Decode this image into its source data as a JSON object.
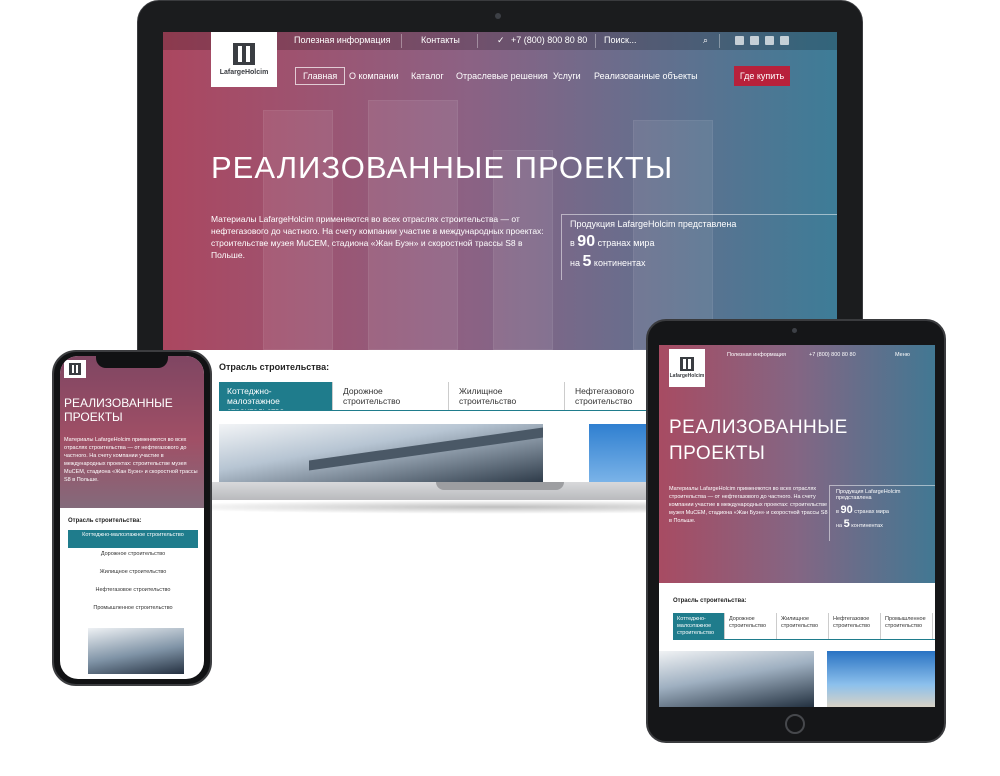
{
  "laptop": {
    "topbar": {
      "info": "Полезная информация",
      "contacts": "Контакты",
      "phone": "+7 (800) 800 80 80",
      "search_placeholder": "Поиск..."
    },
    "logo": "LafargeHolcim",
    "nav": [
      "Главная",
      "О компании",
      "Каталог",
      "Отраслевые решения",
      "Услуги",
      "Реализованные объекты"
    ],
    "buy": "Где купить",
    "title": "РЕАЛИЗОВАННЫЕ ПРОЕКТЫ",
    "description": "Материалы LafargeHolcim применяются во всех отраслях строительства — от нефтегазового до частного. На счету компании участие в международных проектах: строительстве музея MuCEM, стадиона «Жан Буэн» и скоростной трассы S8 в Польше.",
    "stats": {
      "heading": "Продукция LafargeHolcim представлена",
      "countries_prefix": "в",
      "countries_num": "90",
      "countries_suffix": "странах мира",
      "continents_prefix": "на",
      "continents_num": "5",
      "continents_suffix": "континентах"
    },
    "section_label": "Отрасль строительства:",
    "tabs": [
      "Коттеджно-малоэтажное строительство",
      "Дорожное строительство",
      "Жилищное строительство",
      "Нефтегазового строительство"
    ]
  },
  "phone": {
    "title": "РЕАЛИЗОВАННЫЕ ПРОЕКТЫ",
    "description": "Материалы LafargeHolcim применяются во всех отраслях строительства — от нефтегазового до частного. На счету компании участие в международных проектах: строительстве музея MuCEM, стадиона «Жан Буэн» и скоростной трассы S8 в Польше.",
    "section_label": "Отрасль строительства:",
    "tabs": [
      "Коттеджно-малоэтажное строительство",
      "Дорожное строительство",
      "Жилищное строительство",
      "Нефтегазовое строительство",
      "Промышленное строительство"
    ]
  },
  "tablet": {
    "logo": "LafargeHolcim",
    "info": "Полезная информация",
    "phone": "+7 (800) 800 80 80",
    "menu": "Меню",
    "title": "РЕАЛИЗОВАННЫЕ ПРОЕКТЫ",
    "description": "Материалы LafargeHolcim применяются во всех отраслях строительства — от нефтегазового до частного. На счету компании участие в международных проектах: строительстве музея MuCEM, стадиона «Жан Буэн» и скоростной трассы S8 в Польше.",
    "stats": {
      "heading": "Продукция LafargeHolcim представлена",
      "countries_prefix": "в",
      "countries_num": "90",
      "countries_suffix": "странах мира",
      "continents_prefix": "на",
      "continents_num": "5",
      "continents_suffix": "континентах"
    },
    "section_label": "Отрасль строительства:",
    "tabs": [
      "Коттеджно-малоэтажное строительство",
      "Дорожное строительство",
      "Жилищное строительство",
      "Нефтегазовое строительство",
      "Промышленное строительство"
    ]
  },
  "colors": {
    "accent_red": "#b8213b",
    "accent_teal": "#1f7c8c"
  }
}
